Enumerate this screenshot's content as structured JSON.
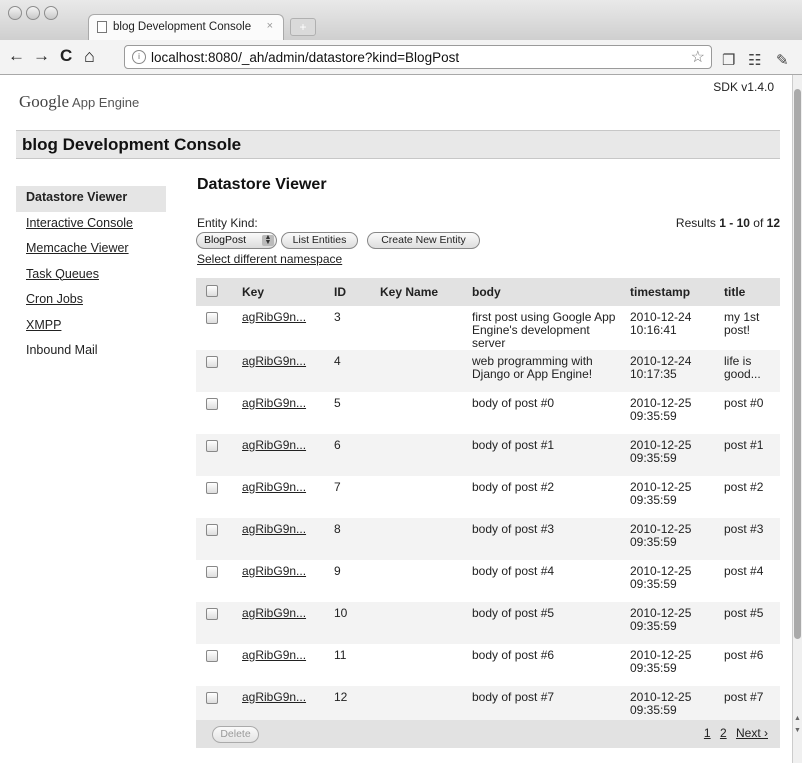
{
  "browser": {
    "tab_title": "blog Development Console",
    "tab_close": "×",
    "new_tab": "+",
    "url": "localhost:8080/_ah/admin/datastore?kind=BlogPost",
    "back": "←",
    "forward": "→",
    "reload": "C",
    "home": "⌂",
    "star": "☆",
    "ext1": "❐",
    "ext2": "☷",
    "ext3": "✎"
  },
  "header": {
    "brand_google": "Google",
    "brand_app_engine": "App Engine",
    "sdk_version": "SDK v1.4.0",
    "console_title": "blog Development Console"
  },
  "sidebar": {
    "items": [
      {
        "label": "Datastore Viewer"
      },
      {
        "label": "Interactive Console"
      },
      {
        "label": "Memcache Viewer"
      },
      {
        "label": "Task Queues"
      },
      {
        "label": "Cron Jobs"
      },
      {
        "label": "XMPP"
      },
      {
        "label": "Inbound Mail"
      }
    ]
  },
  "main": {
    "title": "Datastore Viewer",
    "entity_kind_label": "Entity Kind:",
    "results_prefix": "Results ",
    "results_range": "1 - 10",
    "results_of": " of ",
    "results_total": "12",
    "kind_select": "BlogPost",
    "list_entities": "List Entities",
    "create_entity": "Create New Entity",
    "namespace_link": "Select different namespace"
  },
  "table": {
    "headers": [
      "Key",
      "ID",
      "Key Name",
      "body",
      "timestamp",
      "title"
    ],
    "rows": [
      {
        "key": "agRibG9n...",
        "id": "3",
        "key_name": "",
        "body": "first post using Google App Engine's development server",
        "timestamp": "2010-12-24 10:16:41",
        "title": "my 1st post!"
      },
      {
        "key": "agRibG9n...",
        "id": "4",
        "key_name": "",
        "body": "web programming with Django or App Engine!",
        "timestamp": "2010-12-24 10:17:35",
        "title": "life is good..."
      },
      {
        "key": "agRibG9n...",
        "id": "5",
        "key_name": "",
        "body": "body of post #0",
        "timestamp": "2010-12-25 09:35:59",
        "title": "post #0"
      },
      {
        "key": "agRibG9n...",
        "id": "6",
        "key_name": "",
        "body": "body of post #1",
        "timestamp": "2010-12-25 09:35:59",
        "title": "post #1"
      },
      {
        "key": "agRibG9n...",
        "id": "7",
        "key_name": "",
        "body": "body of post #2",
        "timestamp": "2010-12-25 09:35:59",
        "title": "post #2"
      },
      {
        "key": "agRibG9n...",
        "id": "8",
        "key_name": "",
        "body": "body of post #3",
        "timestamp": "2010-12-25 09:35:59",
        "title": "post #3"
      },
      {
        "key": "agRibG9n...",
        "id": "9",
        "key_name": "",
        "body": "body of post #4",
        "timestamp": "2010-12-25 09:35:59",
        "title": "post #4"
      },
      {
        "key": "agRibG9n...",
        "id": "10",
        "key_name": "",
        "body": "body of post #5",
        "timestamp": "2010-12-25 09:35:59",
        "title": "post #5"
      },
      {
        "key": "agRibG9n...",
        "id": "11",
        "key_name": "",
        "body": "body of post #6",
        "timestamp": "2010-12-25 09:35:59",
        "title": "post #6"
      },
      {
        "key": "agRibG9n...",
        "id": "12",
        "key_name": "",
        "body": "body of post #7",
        "timestamp": "2010-12-25 09:35:59",
        "title": "post #7"
      }
    ]
  },
  "footer": {
    "delete_label": "Delete",
    "page_1": "1",
    "page_2": "2",
    "next": "Next ›"
  }
}
